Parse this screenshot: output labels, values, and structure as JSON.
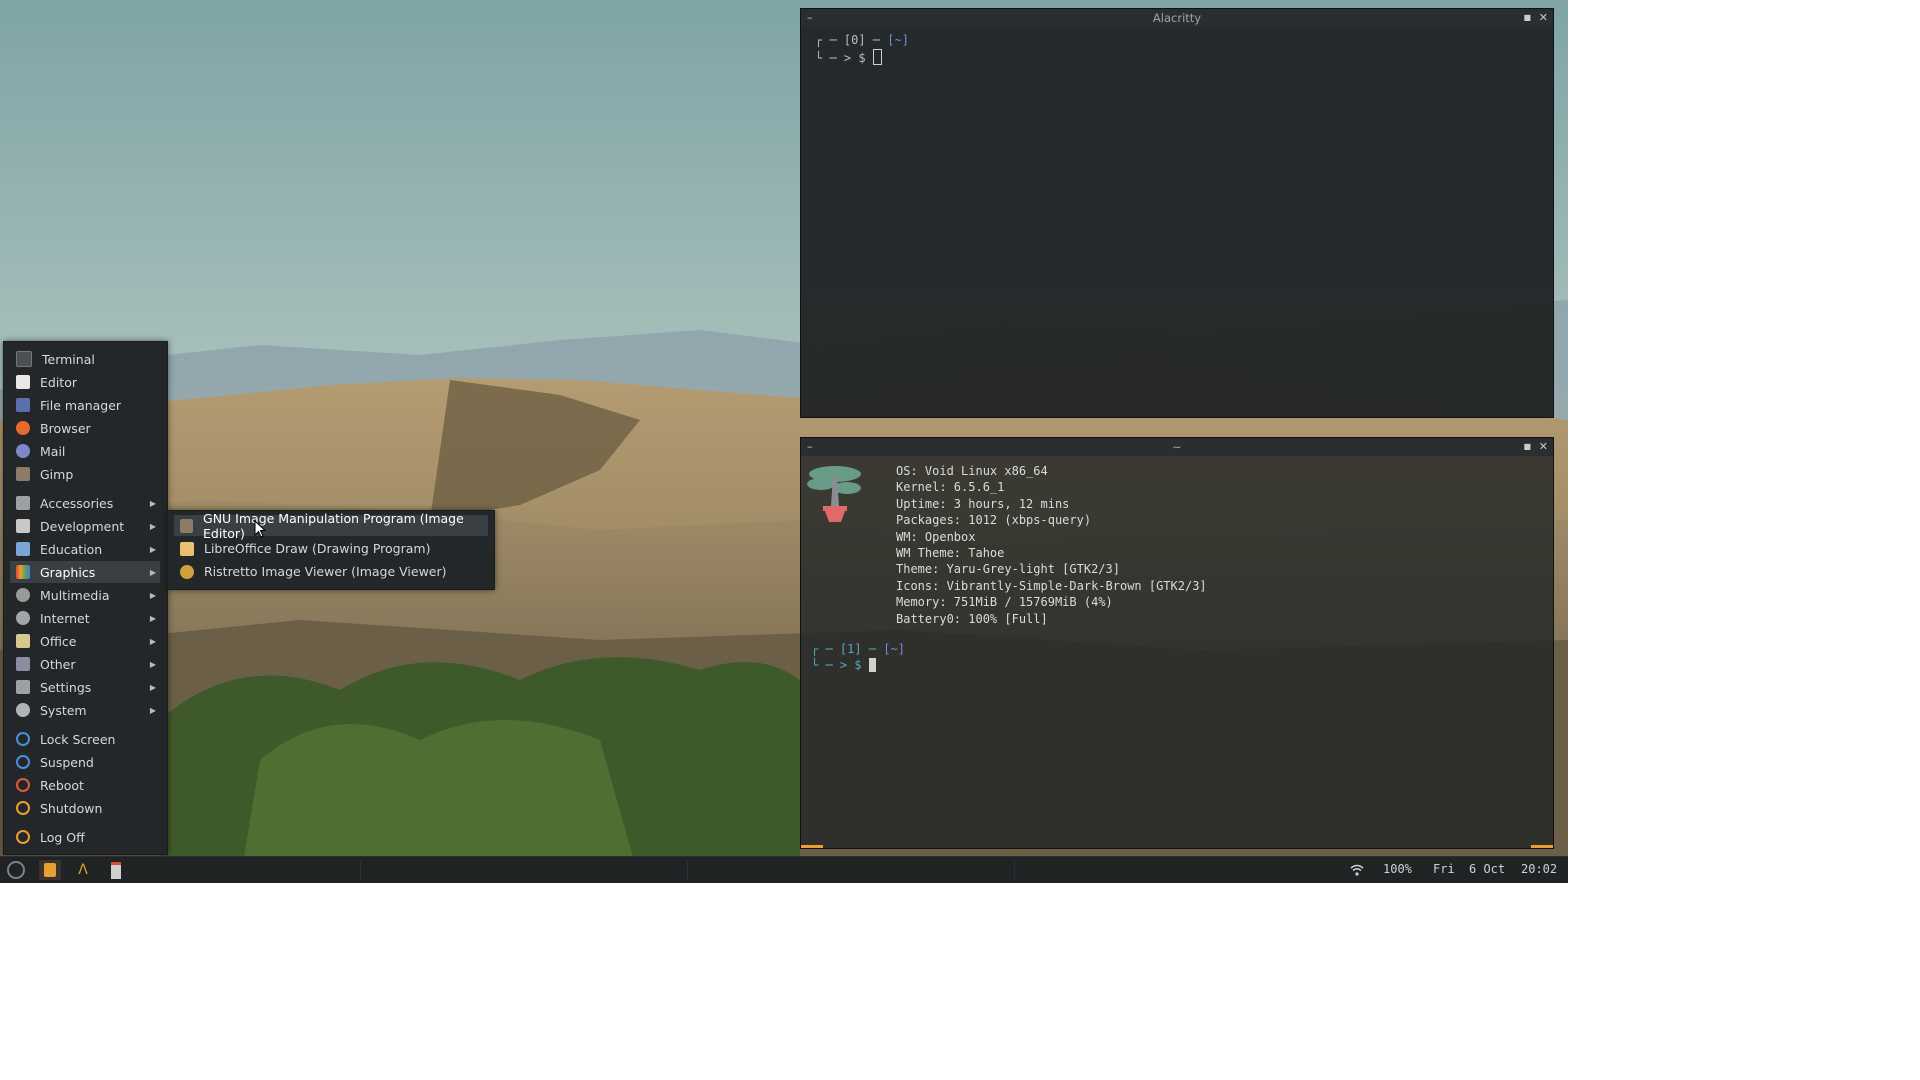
{
  "menu": {
    "items": [
      {
        "label": "Terminal",
        "icon": "terminal-icon",
        "color": "#4b4f52"
      },
      {
        "label": "Editor",
        "icon": "editor-icon",
        "color": "#e8e8e8"
      },
      {
        "label": "File manager",
        "icon": "folder-icon",
        "color": "#5b6fb0"
      },
      {
        "label": "Browser",
        "icon": "firefox-icon",
        "color": "#e66a2c"
      },
      {
        "label": "Mail",
        "icon": "mail-icon",
        "color": "#7d89c8"
      },
      {
        "label": "Gimp",
        "icon": "gimp-icon",
        "color": "#8a7c66"
      }
    ],
    "categories": [
      {
        "label": "Accessories",
        "icon": "accessories-icon",
        "color": "#9aa0a4"
      },
      {
        "label": "Development",
        "icon": "development-icon",
        "color": "#c8c8c8"
      },
      {
        "label": "Education",
        "icon": "education-icon",
        "color": "#7aa6d6"
      },
      {
        "label": "Graphics",
        "icon": "graphics-icon",
        "color": "#d68a3a"
      },
      {
        "label": "Multimedia",
        "icon": "multimedia-icon",
        "color": "#9a9a9a"
      },
      {
        "label": "Internet",
        "icon": "internet-icon",
        "color": "#a0a6aa"
      },
      {
        "label": "Office",
        "icon": "office-icon",
        "color": "#d8c890"
      },
      {
        "label": "Other",
        "icon": "other-icon",
        "color": "#8a8ea0"
      },
      {
        "label": "Settings",
        "icon": "settings-icon",
        "color": "#a0a0a0"
      },
      {
        "label": "System",
        "icon": "system-icon",
        "color": "#b0b4b6"
      }
    ],
    "session": [
      {
        "label": "Lock Screen",
        "icon": "lock-icon",
        "color": "#4a8fd8"
      },
      {
        "label": "Suspend",
        "icon": "suspend-icon",
        "color": "#4a8fd8"
      },
      {
        "label": "Reboot",
        "icon": "reboot-icon",
        "color": "#e05a3a"
      },
      {
        "label": "Shutdown",
        "icon": "shutdown-icon",
        "color": "#e8a030"
      }
    ],
    "logoff": {
      "label": "Log Off",
      "icon": "logoff-icon",
      "color": "#e8a030"
    },
    "active_category": "Graphics"
  },
  "submenu": {
    "items": [
      {
        "label": "GNU Image Manipulation Program (Image Editor)",
        "icon": "gimp-icon",
        "color": "#8a7c66"
      },
      {
        "label": "LibreOffice Draw (Drawing Program)",
        "icon": "libreoffice-draw-icon",
        "color": "#e8c070"
      },
      {
        "label": "Ristretto Image Viewer (Image Viewer)",
        "icon": "image-viewer-icon",
        "color": "#d0a040"
      }
    ]
  },
  "terminal1": {
    "title": "Alacritty",
    "line1": "┌ ─ [0] ─ ",
    "line1_path": "[~]",
    "line2": "└ ─ > $ "
  },
  "terminal2": {
    "title": "~",
    "info": [
      "OS: Void Linux x86_64",
      "Kernel: 6.5.6_1",
      "Uptime: 3 hours, 12 mins",
      "Packages: 1012 (xbps-query)",
      "WM: Openbox",
      "WM Theme: Tahoe",
      "Theme: Yaru-Grey-light [GTK2/3]",
      "Icons: Vibrantly-Simple-Dark-Brown [GTK2/3]",
      "Memory: 751MiB / 15769MiB (4%)",
      "Battery0: 100% [Full]"
    ],
    "prompt1": "┌ ─ [1] ─ ",
    "prompt1_path": "[~]",
    "prompt2": "└ ─ > $ "
  },
  "taskbar": {
    "battery": "100%",
    "day": "Fri",
    "date": "6 Oct",
    "time": "20:02",
    "accent": "#e8a030"
  }
}
